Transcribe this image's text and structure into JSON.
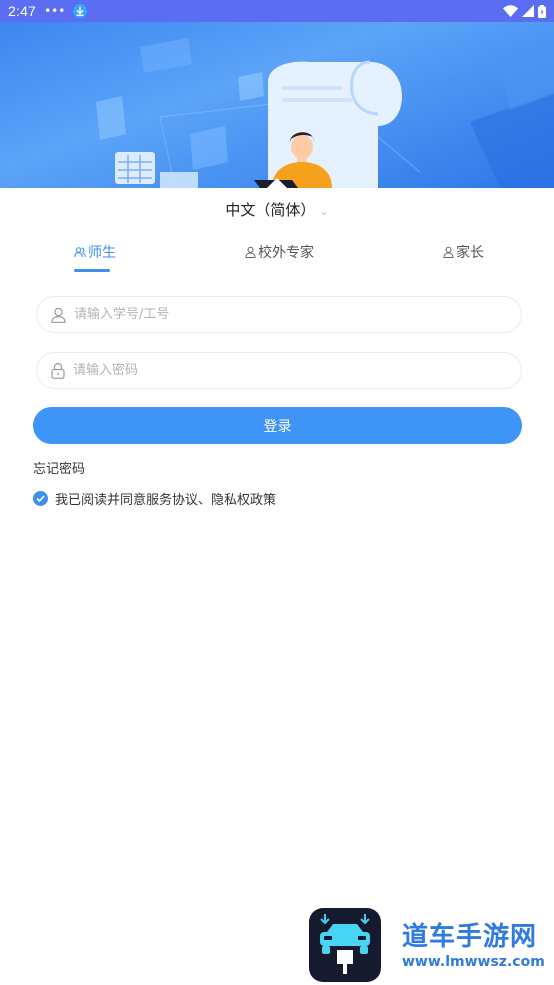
{
  "status_bar": {
    "time": "2:47",
    "dots": "•••",
    "icons": [
      "download-icon",
      "wifi-icon",
      "signal-icon",
      "battery-icon"
    ]
  },
  "language": {
    "label": "中文（简体）",
    "chevron": "⌄"
  },
  "tabs": [
    {
      "label": "师生",
      "icon": "users-icon",
      "active": true
    },
    {
      "label": "校外专家",
      "icon": "user-icon",
      "active": false
    },
    {
      "label": "家长",
      "icon": "user-icon",
      "active": false
    }
  ],
  "form": {
    "account_placeholder": "请输入学号/工号",
    "password_placeholder": "请输入密码",
    "login_label": "登录",
    "forgot_label": "忘记密码",
    "agreement_label": "我已阅读并同意服务协议、隐私权政策",
    "agreement_checked": true
  },
  "watermark": {
    "title": "道车手游网",
    "url": "www.lmwwsz.com"
  },
  "colors": {
    "status_bar": "#5b6ef2",
    "accent": "#3d8ff0",
    "button": "#3e95f7",
    "watermark": "#2f7be0"
  }
}
